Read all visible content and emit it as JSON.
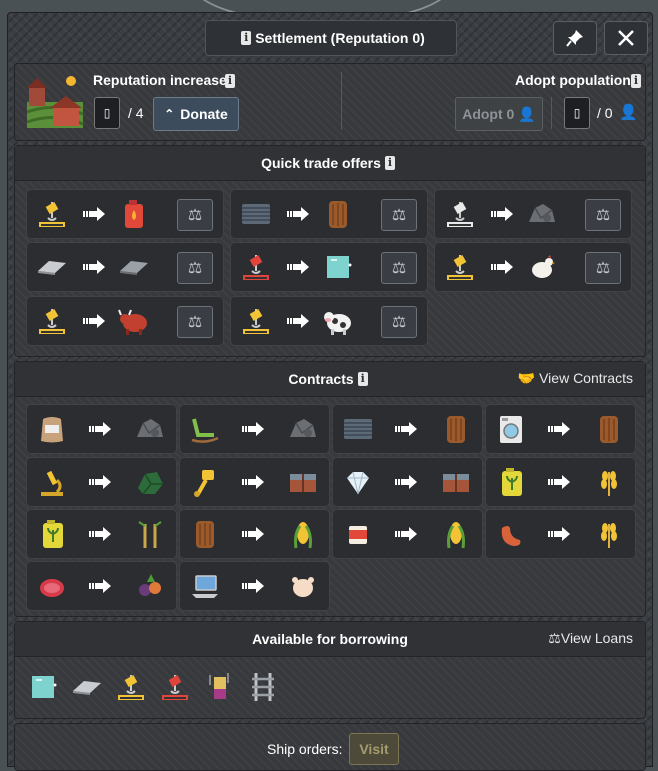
{
  "window": {
    "title": "Settlement (Reputation 0)",
    "pin_icon": "pin-icon",
    "close_icon": "close-icon"
  },
  "reputation": {
    "label": "Reputation increase",
    "value_box": "▯",
    "value_suffix": "/ 4",
    "donate_label": "Donate",
    "adopt_title": "Adopt population",
    "adopt_label": "Adopt 0",
    "pop_box": "▯",
    "pop_suffix": "/ 0"
  },
  "quick_trade": {
    "title": "Quick trade offers",
    "offers": [
      {
        "from": "crane-icon",
        "to": "fuel-canister-icon"
      },
      {
        "from": "steel-beam-icon",
        "to": "wood-log-icon"
      },
      {
        "from": "crane-white-icon",
        "to": "rock-icon"
      },
      {
        "from": "metal-plate-icon",
        "to": "metal-plate-dark-icon"
      },
      {
        "from": "crane-red-icon",
        "to": "glass-icon"
      },
      {
        "from": "crane-icon",
        "to": "chicken-icon"
      },
      {
        "from": "crane-icon",
        "to": "bull-icon"
      },
      {
        "from": "crane-icon",
        "to": "cow-icon"
      }
    ]
  },
  "contracts": {
    "title": "Contracts",
    "view_label": "View Contracts",
    "items": [
      {
        "from": "flour-sack-icon",
        "to": "rock-icon"
      },
      {
        "from": "rocking-chair-icon",
        "to": "rock-icon"
      },
      {
        "from": "steel-beam-icon",
        "to": "wood-log-icon"
      },
      {
        "from": "washing-machine-icon",
        "to": "wood-log-icon"
      },
      {
        "from": "microscope-icon",
        "to": "ore-green-icon"
      },
      {
        "from": "piston-icon",
        "to": "crate-icon"
      },
      {
        "from": "diamond-icon",
        "to": "crate-icon"
      },
      {
        "from": "fertilizer-icon",
        "to": "wheat-icon"
      },
      {
        "from": "fertilizer-icon",
        "to": "sugarcane-icon"
      },
      {
        "from": "wood-log-icon",
        "to": "corn-icon"
      },
      {
        "from": "canned-food-icon",
        "to": "corn-icon"
      },
      {
        "from": "sausage-icon",
        "to": "wheat-icon"
      },
      {
        "from": "meat-icon",
        "to": "vegetables-icon"
      },
      {
        "from": "laptop-icon",
        "to": "chicken-meat-icon"
      }
    ]
  },
  "borrowing": {
    "title": "Available for borrowing",
    "view_label": "View Loans",
    "items": [
      "glass-icon",
      "metal-plate-icon",
      "crane-icon",
      "crane-red-icon",
      "battery-icon",
      "rail-track-icon"
    ]
  },
  "ship": {
    "label": "Ship orders:",
    "visit_label": "Visit"
  }
}
